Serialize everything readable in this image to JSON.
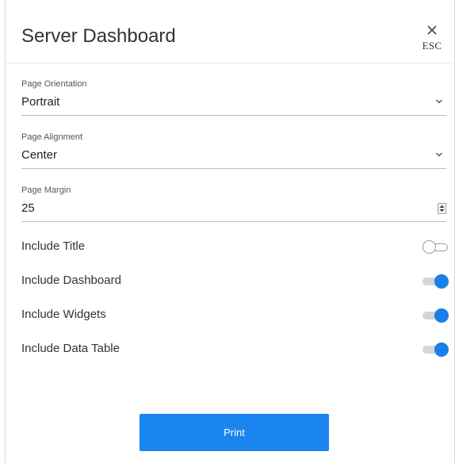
{
  "dialog": {
    "title": "Server Dashboard",
    "close_hint": "ESC"
  },
  "fields": {
    "orientation": {
      "label": "Page Orientation",
      "value": "Portrait"
    },
    "alignment": {
      "label": "Page Alignment",
      "value": "Center"
    },
    "margin": {
      "label": "Page Margin",
      "value": "25"
    }
  },
  "toggles": [
    {
      "label": "Include Title",
      "on": false
    },
    {
      "label": "Include Dashboard",
      "on": true
    },
    {
      "label": "Include Widgets",
      "on": true
    },
    {
      "label": "Include Data Table",
      "on": true
    }
  ],
  "actions": {
    "print_label": "Print"
  },
  "colors": {
    "accent": "#1a84ef",
    "toggle_on": "#1a7fe6",
    "toggle_off_track": "#d5d5d5"
  },
  "icons": {
    "close": "close-icon",
    "dropdown": "chevron-down-icon",
    "stepper": "stepper-icon"
  }
}
